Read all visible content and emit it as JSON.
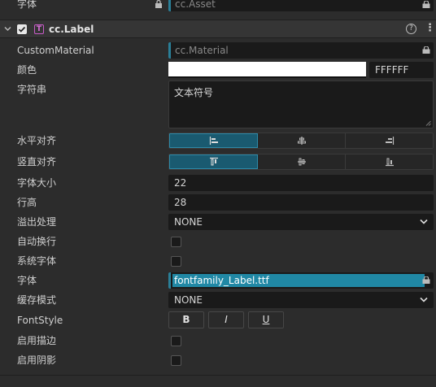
{
  "top_row": {
    "label": "字体",
    "asset": "cc.Asset"
  },
  "component": {
    "title": "cc.Label",
    "help_icon": "?",
    "menu_icon": "⋮"
  },
  "props": {
    "custom_material": {
      "label": "CustomMaterial",
      "value": "cc.Material"
    },
    "color": {
      "label": "颜色",
      "hex": "FFFFFF",
      "swatch": "#ffffff"
    },
    "string": {
      "label": "字符串",
      "value": "文本符号"
    },
    "h_align": {
      "label": "水平对齐",
      "selected": 0
    },
    "v_align": {
      "label": "竖直对齐",
      "selected": 0
    },
    "font_size": {
      "label": "字体大小",
      "value": "22"
    },
    "line_height": {
      "label": "行高",
      "value": "28"
    },
    "overflow": {
      "label": "溢出处理",
      "value": "NONE"
    },
    "wrap": {
      "label": "自动换行",
      "checked": false
    },
    "system_font": {
      "label": "系统字体",
      "checked": false
    },
    "font": {
      "label": "字体",
      "value": "fontfamily_Label.ttf"
    },
    "cache_mode": {
      "label": "缓存模式",
      "value": "NONE"
    },
    "font_style": {
      "label": "FontStyle",
      "bold": "B",
      "italic": "I",
      "underline": "U"
    },
    "outline": {
      "label": "启用描边",
      "checked": false
    },
    "shadow": {
      "label": "启用阴影",
      "checked": false
    }
  },
  "colors": {
    "accent": "#2a7f98",
    "selected_bg": "#1a5a70",
    "font_field_bg": "#2088a5"
  }
}
